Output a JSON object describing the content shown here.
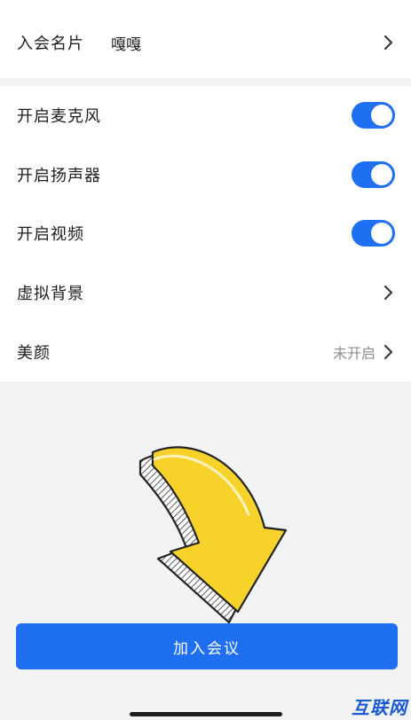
{
  "join_name": {
    "label": "入会名片",
    "value": "嘎嘎"
  },
  "settings": {
    "mic": {
      "label": "开启麦克风",
      "enabled": true
    },
    "speaker": {
      "label": "开启扬声器",
      "enabled": true
    },
    "video": {
      "label": "开启视频",
      "enabled": true
    },
    "virtual_bg": {
      "label": "虚拟背景"
    },
    "beauty": {
      "label": "美颜",
      "status": "未开启"
    }
  },
  "join_button": {
    "label": "加入会议"
  },
  "watermark": {
    "text": "互联网"
  },
  "colors": {
    "accent": "#1f6ff2",
    "background": "#f2f3f5",
    "arrow_yellow": "#f6d22a"
  },
  "icons": {
    "chevron": "chevron-right-icon",
    "overlay": "curved-down-arrow-icon"
  }
}
